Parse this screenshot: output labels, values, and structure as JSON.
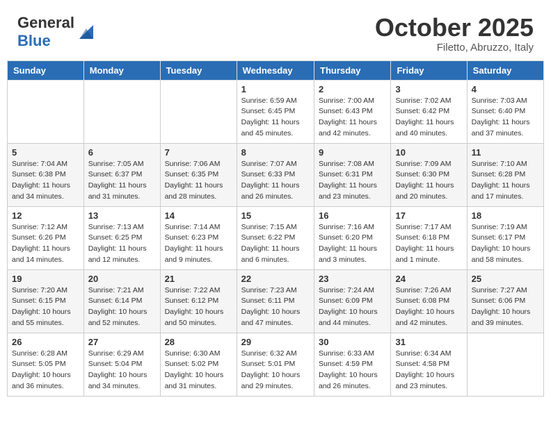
{
  "header": {
    "logo_general": "General",
    "logo_blue": "Blue",
    "month": "October 2025",
    "location": "Filetto, Abruzzo, Italy"
  },
  "days_of_week": [
    "Sunday",
    "Monday",
    "Tuesday",
    "Wednesday",
    "Thursday",
    "Friday",
    "Saturday"
  ],
  "weeks": [
    [
      {
        "day": "",
        "info": ""
      },
      {
        "day": "",
        "info": ""
      },
      {
        "day": "",
        "info": ""
      },
      {
        "day": "1",
        "info": "Sunrise: 6:59 AM\nSunset: 6:45 PM\nDaylight: 11 hours\nand 45 minutes."
      },
      {
        "day": "2",
        "info": "Sunrise: 7:00 AM\nSunset: 6:43 PM\nDaylight: 11 hours\nand 42 minutes."
      },
      {
        "day": "3",
        "info": "Sunrise: 7:02 AM\nSunset: 6:42 PM\nDaylight: 11 hours\nand 40 minutes."
      },
      {
        "day": "4",
        "info": "Sunrise: 7:03 AM\nSunset: 6:40 PM\nDaylight: 11 hours\nand 37 minutes."
      }
    ],
    [
      {
        "day": "5",
        "info": "Sunrise: 7:04 AM\nSunset: 6:38 PM\nDaylight: 11 hours\nand 34 minutes."
      },
      {
        "day": "6",
        "info": "Sunrise: 7:05 AM\nSunset: 6:37 PM\nDaylight: 11 hours\nand 31 minutes."
      },
      {
        "day": "7",
        "info": "Sunrise: 7:06 AM\nSunset: 6:35 PM\nDaylight: 11 hours\nand 28 minutes."
      },
      {
        "day": "8",
        "info": "Sunrise: 7:07 AM\nSunset: 6:33 PM\nDaylight: 11 hours\nand 26 minutes."
      },
      {
        "day": "9",
        "info": "Sunrise: 7:08 AM\nSunset: 6:31 PM\nDaylight: 11 hours\nand 23 minutes."
      },
      {
        "day": "10",
        "info": "Sunrise: 7:09 AM\nSunset: 6:30 PM\nDaylight: 11 hours\nand 20 minutes."
      },
      {
        "day": "11",
        "info": "Sunrise: 7:10 AM\nSunset: 6:28 PM\nDaylight: 11 hours\nand 17 minutes."
      }
    ],
    [
      {
        "day": "12",
        "info": "Sunrise: 7:12 AM\nSunset: 6:26 PM\nDaylight: 11 hours\nand 14 minutes."
      },
      {
        "day": "13",
        "info": "Sunrise: 7:13 AM\nSunset: 6:25 PM\nDaylight: 11 hours\nand 12 minutes."
      },
      {
        "day": "14",
        "info": "Sunrise: 7:14 AM\nSunset: 6:23 PM\nDaylight: 11 hours\nand 9 minutes."
      },
      {
        "day": "15",
        "info": "Sunrise: 7:15 AM\nSunset: 6:22 PM\nDaylight: 11 hours\nand 6 minutes."
      },
      {
        "day": "16",
        "info": "Sunrise: 7:16 AM\nSunset: 6:20 PM\nDaylight: 11 hours\nand 3 minutes."
      },
      {
        "day": "17",
        "info": "Sunrise: 7:17 AM\nSunset: 6:18 PM\nDaylight: 11 hours\nand 1 minute."
      },
      {
        "day": "18",
        "info": "Sunrise: 7:19 AM\nSunset: 6:17 PM\nDaylight: 10 hours\nand 58 minutes."
      }
    ],
    [
      {
        "day": "19",
        "info": "Sunrise: 7:20 AM\nSunset: 6:15 PM\nDaylight: 10 hours\nand 55 minutes."
      },
      {
        "day": "20",
        "info": "Sunrise: 7:21 AM\nSunset: 6:14 PM\nDaylight: 10 hours\nand 52 minutes."
      },
      {
        "day": "21",
        "info": "Sunrise: 7:22 AM\nSunset: 6:12 PM\nDaylight: 10 hours\nand 50 minutes."
      },
      {
        "day": "22",
        "info": "Sunrise: 7:23 AM\nSunset: 6:11 PM\nDaylight: 10 hours\nand 47 minutes."
      },
      {
        "day": "23",
        "info": "Sunrise: 7:24 AM\nSunset: 6:09 PM\nDaylight: 10 hours\nand 44 minutes."
      },
      {
        "day": "24",
        "info": "Sunrise: 7:26 AM\nSunset: 6:08 PM\nDaylight: 10 hours\nand 42 minutes."
      },
      {
        "day": "25",
        "info": "Sunrise: 7:27 AM\nSunset: 6:06 PM\nDaylight: 10 hours\nand 39 minutes."
      }
    ],
    [
      {
        "day": "26",
        "info": "Sunrise: 6:28 AM\nSunset: 5:05 PM\nDaylight: 10 hours\nand 36 minutes."
      },
      {
        "day": "27",
        "info": "Sunrise: 6:29 AM\nSunset: 5:04 PM\nDaylight: 10 hours\nand 34 minutes."
      },
      {
        "day": "28",
        "info": "Sunrise: 6:30 AM\nSunset: 5:02 PM\nDaylight: 10 hours\nand 31 minutes."
      },
      {
        "day": "29",
        "info": "Sunrise: 6:32 AM\nSunset: 5:01 PM\nDaylight: 10 hours\nand 29 minutes."
      },
      {
        "day": "30",
        "info": "Sunrise: 6:33 AM\nSunset: 4:59 PM\nDaylight: 10 hours\nand 26 minutes."
      },
      {
        "day": "31",
        "info": "Sunrise: 6:34 AM\nSunset: 4:58 PM\nDaylight: 10 hours\nand 23 minutes."
      },
      {
        "day": "",
        "info": ""
      }
    ]
  ]
}
